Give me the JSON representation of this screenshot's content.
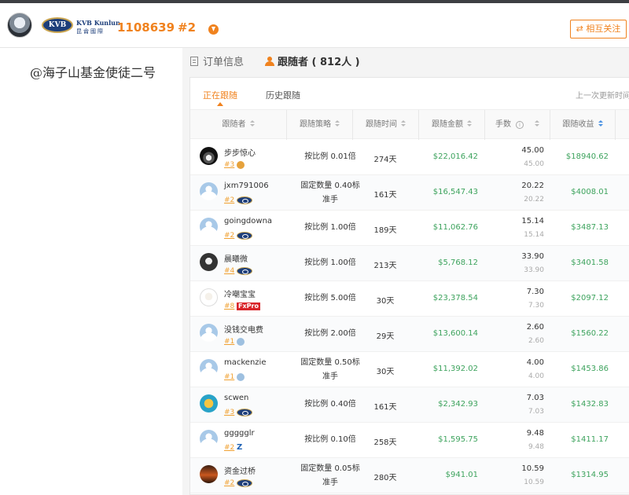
{
  "header": {
    "broker_logo_text": "KVB",
    "broker_name_en": "KVB Kunlun",
    "broker_name_cn": "昆侖國際",
    "account_id": "1108639",
    "rank": "#2",
    "follow_button": "⇄ 相互关注"
  },
  "profile": {
    "nickname": "@海子山基金使徒二号"
  },
  "tabs": {
    "order_info": "订单信息",
    "followers": "跟随者 ( 812人 )"
  },
  "subtabs": {
    "current": "正在跟随",
    "history": "历史跟随",
    "last_update": "上一次更新时间"
  },
  "columns": [
    "跟随者",
    "跟随策略",
    "跟随时间",
    "跟随金额",
    "手数",
    "跟随收益"
  ],
  "colors": {
    "accent": "#f0821e",
    "money": "#3da35d"
  },
  "rows": [
    {
      "name": "步步惊心",
      "rank": "#3",
      "broker": "gold",
      "strategy": "按比例 0.01倍",
      "time": "274天",
      "amount": "$22,016.42",
      "lots": "45.00",
      "lots2": "45.00",
      "profit": "$18940.62",
      "avatar": "photo1"
    },
    {
      "name": "jxm791006",
      "rank": "#2",
      "broker": "kvb",
      "strategy": "固定数量 0.40标准手",
      "time": "161天",
      "amount": "$16,547.43",
      "lots": "20.22",
      "lots2": "20.22",
      "profit": "$4008.01",
      "avatar": "default"
    },
    {
      "name": "goingdowna",
      "rank": "#2",
      "broker": "kvb",
      "strategy": "按比例 1.00倍",
      "time": "189天",
      "amount": "$11,062.76",
      "lots": "15.14",
      "lots2": "15.14",
      "profit": "$3487.13",
      "avatar": "default"
    },
    {
      "name": "晨曦微",
      "rank": "#4",
      "broker": "kvb",
      "strategy": "按比例 1.00倍",
      "time": "213天",
      "amount": "$5,768.12",
      "lots": "33.90",
      "lots2": "33.90",
      "profit": "$3401.58",
      "avatar": "dark"
    },
    {
      "name": "冷嘲宝宝",
      "rank": "#8",
      "broker": "fxpro",
      "broker_text": "FxPro",
      "strategy": "按比例 5.00倍",
      "time": "30天",
      "amount": "$23,378.54",
      "lots": "7.30",
      "lots2": "7.30",
      "profit": "$2097.12",
      "avatar": "cat"
    },
    {
      "name": "没钱交电费",
      "rank": "#1",
      "broker": "person",
      "strategy": "按比例 2.00倍",
      "time": "29天",
      "amount": "$13,600.14",
      "lots": "2.60",
      "lots2": "2.60",
      "profit": "$1560.22",
      "avatar": "default"
    },
    {
      "name": "mackenzie",
      "rank": "#1",
      "broker": "person",
      "strategy": "固定数量 0.50标准手",
      "time": "30天",
      "amount": "$11,392.02",
      "lots": "4.00",
      "lots2": "4.00",
      "profit": "$1453.86",
      "avatar": "default"
    },
    {
      "name": "scwen",
      "rank": "#3",
      "broker": "kvb",
      "strategy": "按比例 0.40倍",
      "time": "161天",
      "amount": "$2,342.93",
      "lots": "7.03",
      "lots2": "7.03",
      "profit": "$1432.83",
      "avatar": "cartoon"
    },
    {
      "name": "ggggglr",
      "rank": "#2",
      "broker": "z",
      "broker_text": "Z",
      "strategy": "按比例 0.10倍",
      "time": "258天",
      "amount": "$1,595.75",
      "lots": "9.48",
      "lots2": "9.48",
      "profit": "$1411.17",
      "avatar": "default"
    },
    {
      "name": "资金过桥",
      "rank": "#2",
      "broker": "kvb",
      "strategy": "固定数量 0.05标准手",
      "time": "280天",
      "amount": "$941.01",
      "lots": "10.59",
      "lots2": "10.59",
      "profit": "$1314.95",
      "avatar": "sunset"
    }
  ]
}
